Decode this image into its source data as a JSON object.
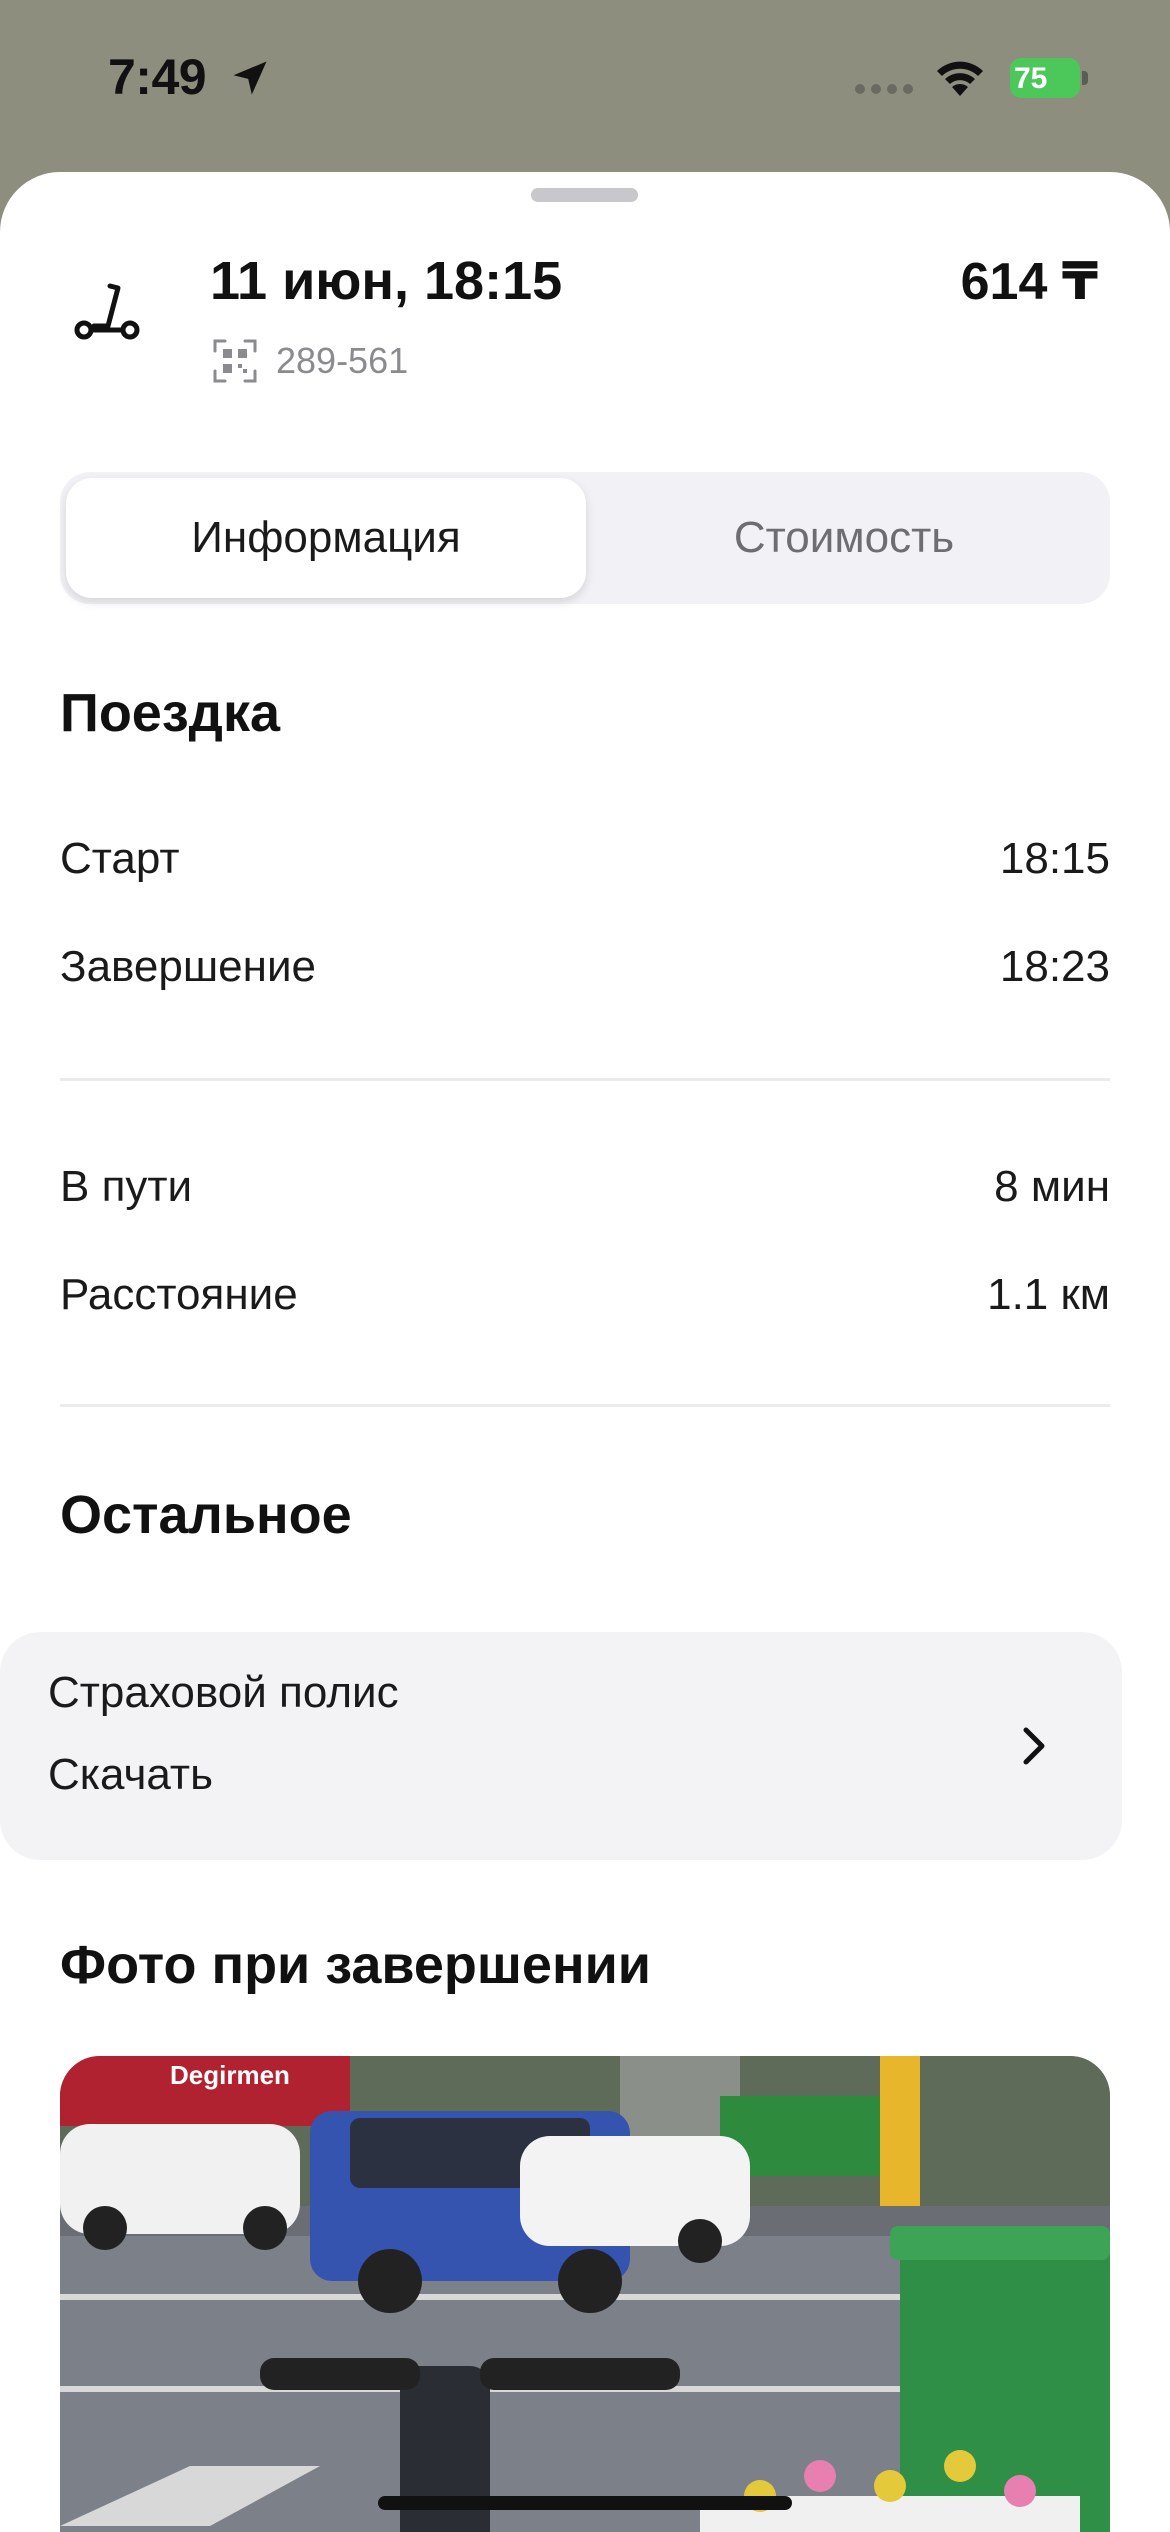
{
  "status_bar": {
    "time": "7:49",
    "battery": "75"
  },
  "trip": {
    "title": "11 июн, 18:15",
    "scooter_id": "289-561",
    "price": "614 ₸"
  },
  "tabs": {
    "info": "Информация",
    "cost": "Стоимость"
  },
  "ride": {
    "title": "Поездка",
    "start_label": "Старт",
    "start_value": "18:15",
    "end_label": "Завершение",
    "end_value": "18:23",
    "duration_label": "В пути",
    "duration_value": "8 мин",
    "distance_label": "Расстояние",
    "distance_value": "1.1 км"
  },
  "other": {
    "title": "Остальное",
    "insurance_title": "Страховой полис",
    "insurance_action": "Скачать"
  },
  "photo_section": {
    "title": "Фото при завершении",
    "sign_text": "Degirmen"
  },
  "colors": {
    "battery": "#4cc75a",
    "sheet_bg": "#ffffff",
    "card_bg": "#f3f3f6",
    "status_bg": "#8d8e7e"
  }
}
